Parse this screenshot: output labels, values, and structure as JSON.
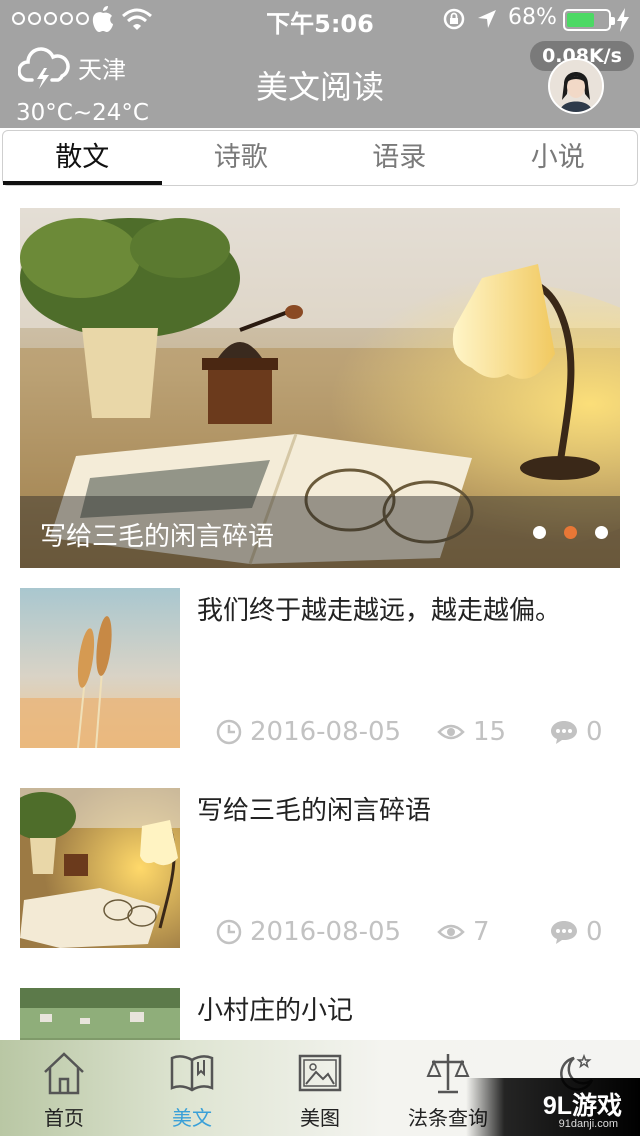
{
  "status_bar": {
    "time": "下午5:06",
    "battery_percent": "68%",
    "battery_level": 0.68
  },
  "header": {
    "city": "天津",
    "temperature": "30°C~24°C",
    "title": "美文阅读",
    "network_speed": "0.08K/s"
  },
  "tabs": [
    {
      "label": "散文",
      "active": true
    },
    {
      "label": "诗歌",
      "active": false
    },
    {
      "label": "语录",
      "active": false
    },
    {
      "label": "小说",
      "active": false
    }
  ],
  "banner": {
    "title": "写给三毛的闲言碎语",
    "slide_count": 3,
    "active_slide": 2
  },
  "articles": [
    {
      "title": "我们终于越走越远，越走越偏。",
      "date": "2016-08-05",
      "views": "15",
      "comments": "0"
    },
    {
      "title": "写给三毛的闲言碎语",
      "date": "2016-08-05",
      "views": "7",
      "comments": "0"
    },
    {
      "title": "小村庄的小记"
    }
  ],
  "tabbar": [
    {
      "label": "首页",
      "icon": "home-icon"
    },
    {
      "label": "美文",
      "icon": "book-icon",
      "active": true
    },
    {
      "label": "美图",
      "icon": "picture-icon"
    },
    {
      "label": "法条查询",
      "icon": "scale-icon"
    },
    {
      "label": "",
      "icon": "moon-stars-icon"
    }
  ],
  "watermark": {
    "logo": "9L游戏",
    "site": "91danji.com"
  },
  "colors": {
    "accent_orange": "#e87736",
    "active_tab_blue": "#3aa0d8",
    "battery_green": "#4cd964",
    "header_gray": "#a3a3a3"
  }
}
